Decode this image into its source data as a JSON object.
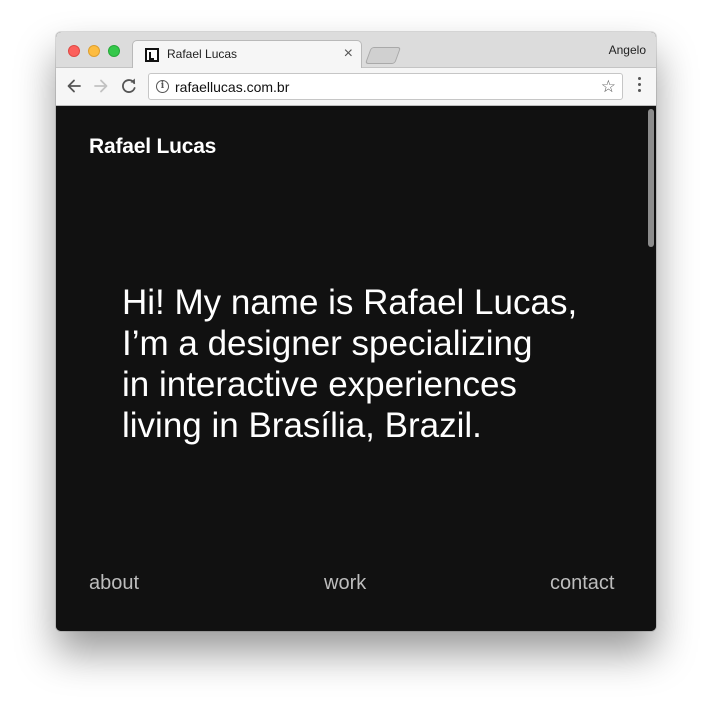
{
  "browser": {
    "tab": {
      "title": "Rafael Lucas",
      "close_glyph": "×",
      "favicon": "site-logo-icon"
    },
    "profile_name": "Angelo",
    "address_bar": {
      "url": "rafaellucas.com.br",
      "info_glyph": "i",
      "star_glyph": "☆"
    },
    "traffic_lights": {
      "close_color": "#fc605c",
      "minimize_color": "#fdbc40",
      "maximize_color": "#34c84a"
    }
  },
  "page": {
    "background": "#111111",
    "logo": "Rafael Lucas",
    "hero_lines": [
      "Hi! My name is Rafael Lucas,",
      "I’m a designer specializing",
      "in interactive experiences",
      "living in Brasília, Brazil."
    ],
    "nav": {
      "about": "about",
      "work": "work",
      "contact": "contact"
    }
  }
}
